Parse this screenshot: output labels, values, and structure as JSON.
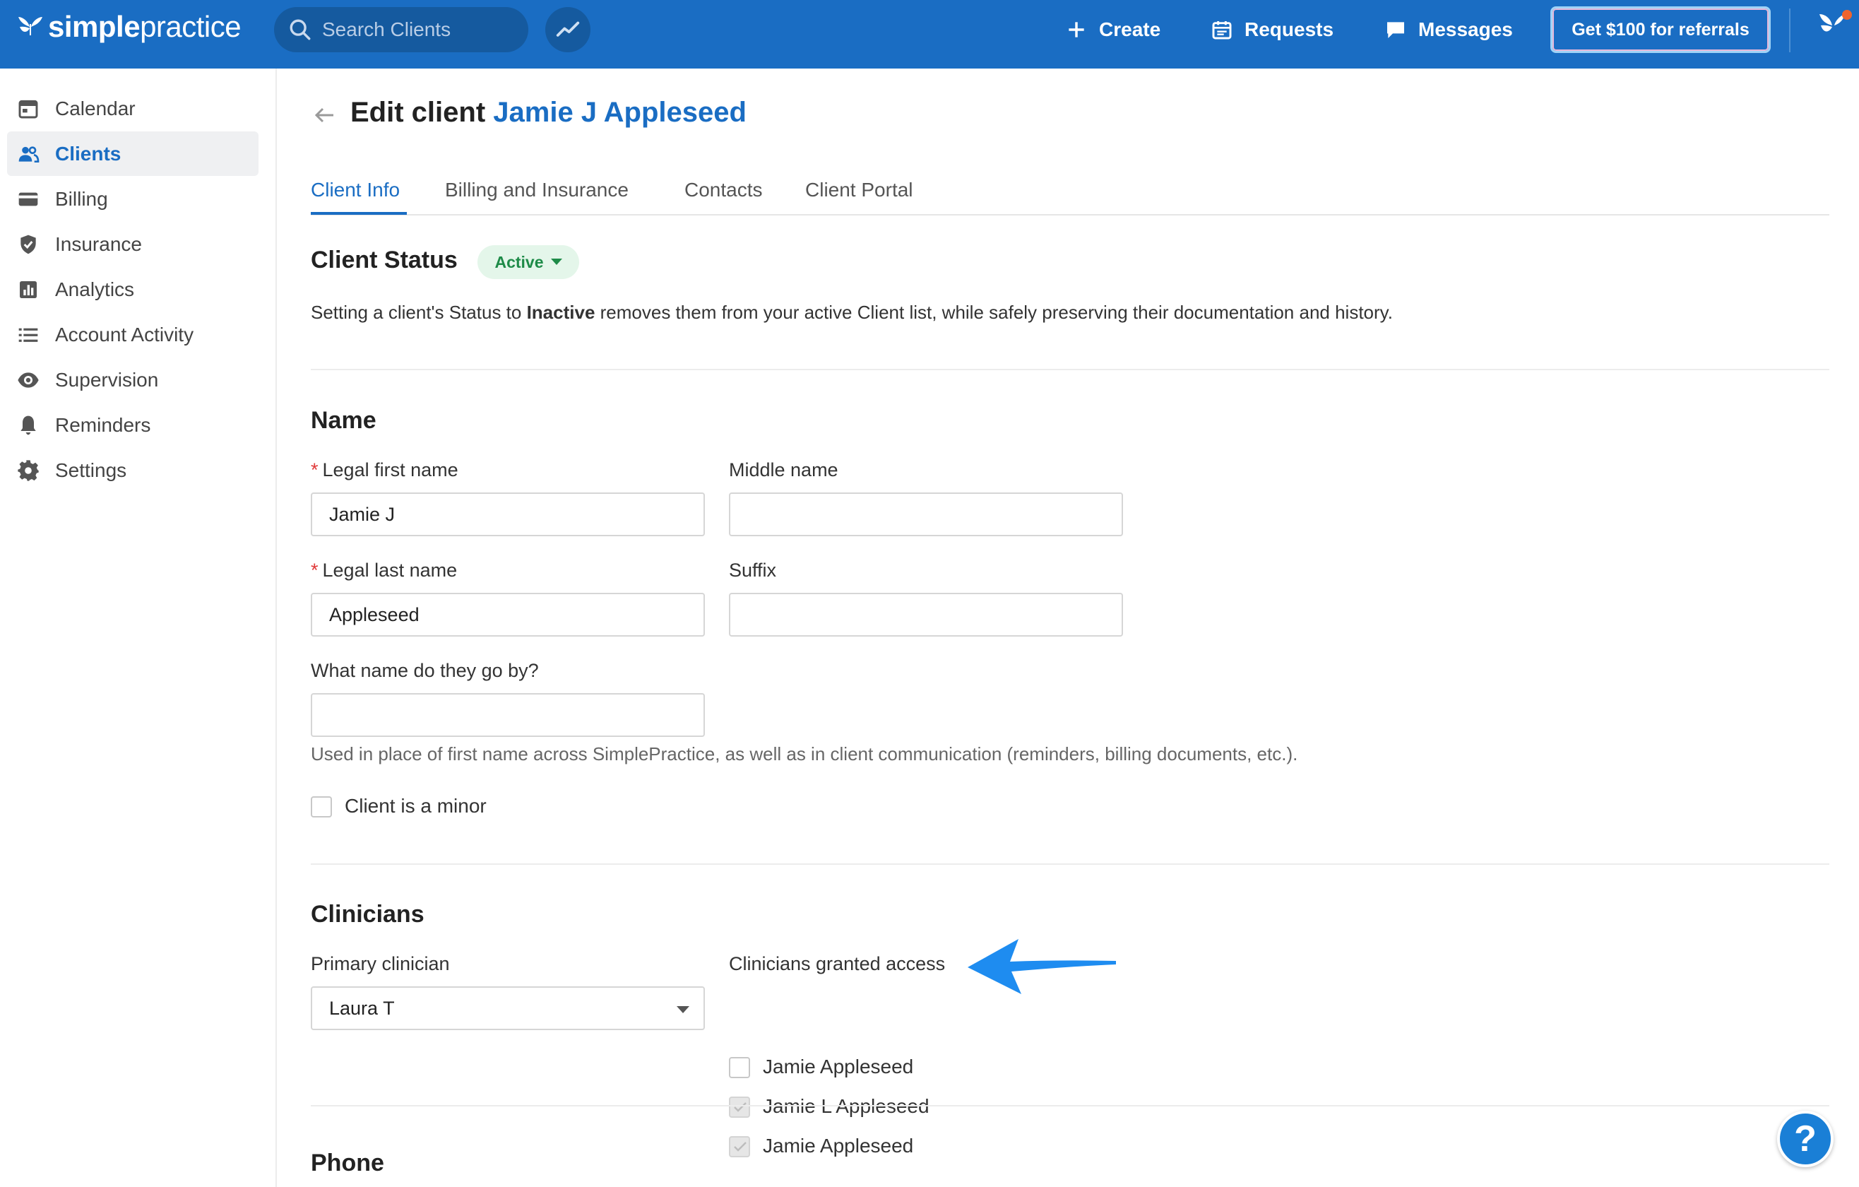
{
  "header": {
    "logo_bold": "simple",
    "logo_light": "practice",
    "search_placeholder": "Search Clients",
    "create_label": "Create",
    "requests_label": "Requests",
    "messages_label": "Messages",
    "referral_label": "Get $100 for referrals"
  },
  "sidebar": {
    "items": [
      {
        "label": "Calendar",
        "icon": "calendar-icon"
      },
      {
        "label": "Clients",
        "icon": "clients-icon",
        "active": true
      },
      {
        "label": "Billing",
        "icon": "billing-icon"
      },
      {
        "label": "Insurance",
        "icon": "insurance-shield-icon"
      },
      {
        "label": "Analytics",
        "icon": "analytics-icon"
      },
      {
        "label": "Account Activity",
        "icon": "list-icon"
      },
      {
        "label": "Supervision",
        "icon": "eye-icon"
      },
      {
        "label": "Reminders",
        "icon": "bell-icon"
      },
      {
        "label": "Settings",
        "icon": "gear-icon"
      }
    ]
  },
  "page": {
    "title_prefix": "Edit client",
    "client_name": "Jamie J Appleseed"
  },
  "tabs": [
    {
      "label": "Client Info",
      "active": true
    },
    {
      "label": "Billing and Insurance"
    },
    {
      "label": "Contacts"
    },
    {
      "label": "Client Portal"
    }
  ],
  "status": {
    "heading": "Client Status",
    "badge": "Active",
    "text_before": "Setting a client's Status to ",
    "text_bold": "Inactive",
    "text_after": " removes them from your active Client list, while safely preserving their documentation and history."
  },
  "name_section": {
    "heading": "Name",
    "required_mark": "*",
    "first_name_label": "Legal first name",
    "first_name_value": "Jamie J",
    "middle_name_label": "Middle name",
    "middle_name_value": "",
    "last_name_label": "Legal last name",
    "last_name_value": "Appleseed",
    "suffix_label": "Suffix",
    "suffix_value": "",
    "go_by_label": "What name do they go by?",
    "go_by_value": "",
    "go_by_help": "Used in place of first name across SimplePractice, as well as in client communication (reminders, billing documents, etc.).",
    "minor_label": "Client is a minor",
    "minor_checked": false
  },
  "clinicians": {
    "heading": "Clinicians",
    "primary_label": "Primary clinician",
    "primary_value": "Laura T",
    "access_label": "Clinicians granted access",
    "access_list": [
      {
        "name": "Jamie Appleseed",
        "checked": false
      },
      {
        "name": "Jamie L Appleseed",
        "checked": true
      },
      {
        "name": "Jamie Appleseed",
        "checked": true
      }
    ]
  },
  "phone_section": {
    "heading": "Phone"
  },
  "help_button": "?",
  "colors": {
    "brand_blue": "#1a6dc3",
    "active_green": "#1e8b48",
    "annotation_arrow": "#1e8cf0"
  }
}
